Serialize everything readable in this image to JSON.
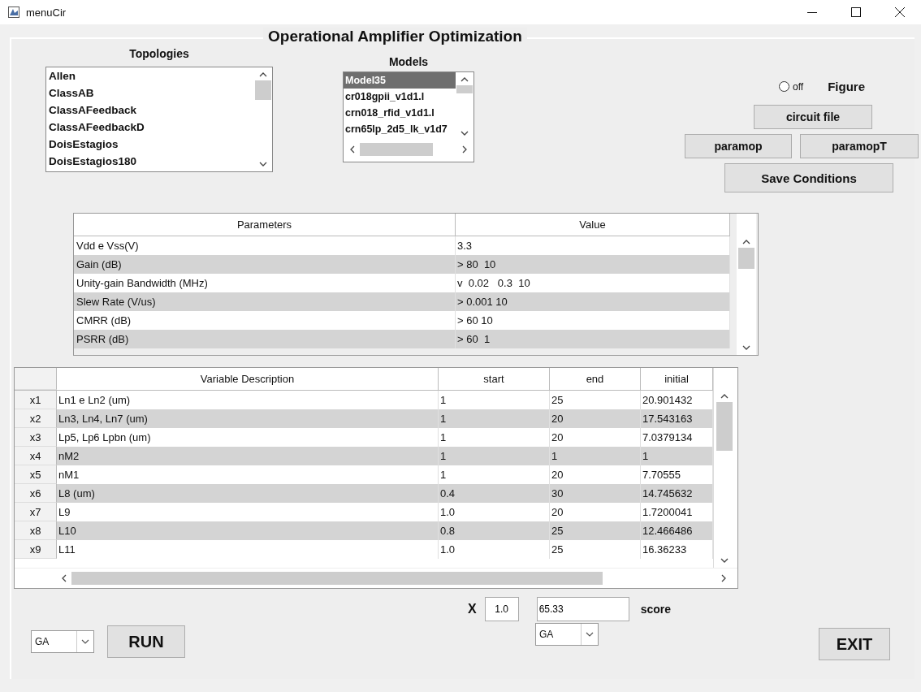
{
  "window": {
    "title": "menuCir"
  },
  "panel": {
    "title": "Operational Amplifier Optimization"
  },
  "topologies": {
    "label": "Topologies",
    "items": [
      {
        "text": "Allen",
        "selected": false
      },
      {
        "text": "ClassAB",
        "selected": false
      },
      {
        "text": "ClassAFeedback",
        "selected": false
      },
      {
        "text": "ClassAFeedbackD",
        "selected": false
      },
      {
        "text": "DoisEstagios",
        "selected": false
      },
      {
        "text": "DoisEstagios180",
        "selected": false
      }
    ]
  },
  "models": {
    "label": "Models",
    "items": [
      {
        "text": "Model35",
        "selected": true
      },
      {
        "text": "cr018gpii_v1d1.l",
        "selected": false
      },
      {
        "text": "crn018_rfid_v1d1.l",
        "selected": false
      },
      {
        "text": "crn65lp_2d5_lk_v1d7",
        "selected": false
      }
    ]
  },
  "figure": {
    "radio_label": "off",
    "checked": false,
    "label": "Figure"
  },
  "buttons": {
    "circuit_file": "circuit file",
    "paramop": "paramop",
    "paramopT": "paramopT",
    "save": "Save Conditions",
    "run": "RUN",
    "exit": "EXIT"
  },
  "parameters": {
    "columns": [
      "Parameters",
      "Value"
    ],
    "rows": [
      [
        "Vdd e Vss(V)",
        "3.3"
      ],
      [
        "Gain (dB)",
        "> 80  10"
      ],
      [
        "Unity-gain Bandwidth (MHz)",
        "v  0.02   0.3  10"
      ],
      [
        "Slew Rate (V/us)",
        "> 0.001 10"
      ],
      [
        "CMRR (dB)",
        "> 60 10"
      ],
      [
        "PSRR (dB)",
        "> 60  1"
      ]
    ]
  },
  "variables": {
    "columns": [
      "Variable Description",
      "start",
      "end",
      "initial"
    ],
    "rows": [
      {
        "id": "x1",
        "cells": [
          "Ln1 e Ln2 (um)",
          "1",
          "25",
          "20.901432"
        ]
      },
      {
        "id": "x2",
        "cells": [
          "Ln3, Ln4, Ln7 (um)",
          "1",
          "20",
          "17.543163"
        ]
      },
      {
        "id": "x3",
        "cells": [
          "Lp5, Lp6 Lpbn (um)",
          "1",
          "20",
          "7.0379134"
        ]
      },
      {
        "id": "x4",
        "cells": [
          "nM2",
          "1",
          "1",
          "1"
        ]
      },
      {
        "id": "x5",
        "cells": [
          "nM1",
          "1",
          "20",
          "7.70555"
        ]
      },
      {
        "id": "x6",
        "cells": [
          "L8 (um)",
          "0.4",
          "30",
          "14.745632"
        ]
      },
      {
        "id": "x7",
        "cells": [
          "L9",
          "1.0",
          "20",
          "1.7200041"
        ]
      },
      {
        "id": "x8",
        "cells": [
          "L10",
          "0.8",
          "25",
          "12.466486"
        ]
      },
      {
        "id": "x9",
        "cells": [
          "L11",
          "1.0",
          "25",
          "16.36233"
        ]
      }
    ]
  },
  "x_label": "X",
  "x_value": "1.0",
  "score_value": "65.33",
  "score_label": "score",
  "method_right": "GA",
  "method_left": "GA"
}
